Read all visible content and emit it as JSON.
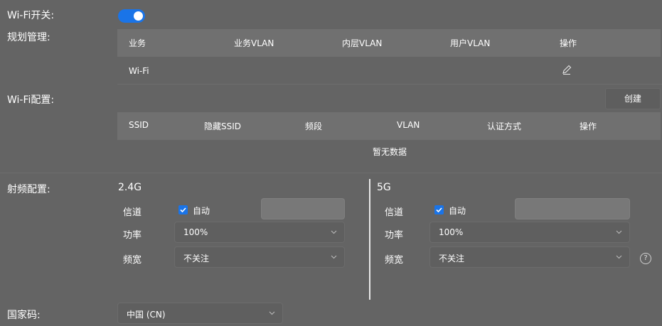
{
  "wifi_switch": {
    "label": "Wi-Fi开关:",
    "enabled": true
  },
  "plan_mgmt": {
    "label": "规划管理:",
    "columns": [
      "业务",
      "业务VLAN",
      "内层VLAN",
      "用户VLAN",
      "操作"
    ],
    "rows": [
      {
        "service": "Wi-Fi",
        "service_vlan": "",
        "inner_vlan": "",
        "user_vlan": "",
        "action_icon": "edit-pencil-icon"
      }
    ]
  },
  "wifi_config": {
    "label": "Wi-Fi配置:",
    "create_button": "创建",
    "columns": [
      "SSID",
      "隐藏SSID",
      "频段",
      "VLAN",
      "认证方式",
      "操作"
    ],
    "empty_text": "暂无数据"
  },
  "radio_config": {
    "label": "射频配置:",
    "band_24": {
      "title": "2.4G",
      "channel_label": "信道",
      "auto_label": "自动",
      "auto_checked": true,
      "power_label": "功率",
      "power_value": "100%",
      "bandwidth_label": "频宽",
      "bandwidth_value": "不关注"
    },
    "band_5": {
      "title": "5G",
      "channel_label": "信道",
      "auto_label": "自动",
      "auto_checked": true,
      "power_label": "功率",
      "power_value": "100%",
      "bandwidth_label": "频宽",
      "bandwidth_value": "不关注"
    },
    "help_icon": "question-circle-icon",
    "help_glyph": "?"
  },
  "country": {
    "label": "国家码:",
    "value": "中国 (CN)"
  },
  "colors": {
    "background": "#646464",
    "table_header": "#707070",
    "accent": "#1a74e8",
    "text": "#ffffff"
  }
}
